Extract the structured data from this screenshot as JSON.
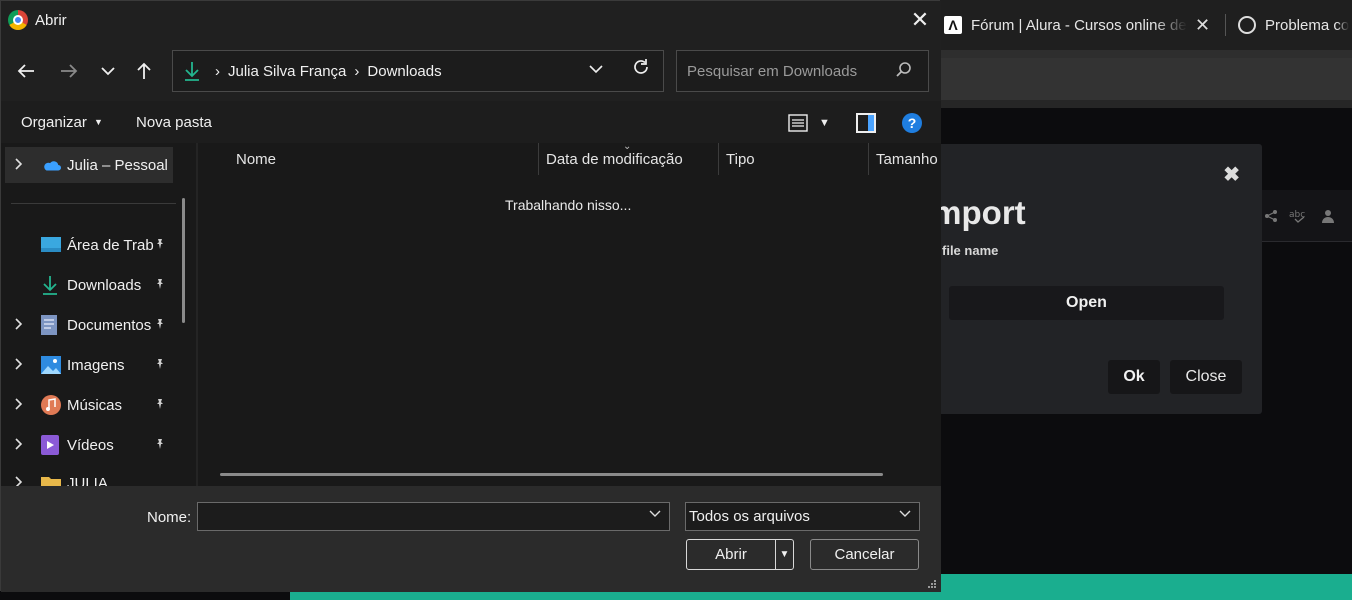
{
  "dialog": {
    "title": "Abrir",
    "breadcrumb": [
      "Julia Silva França",
      "Downloads"
    ],
    "search_placeholder": "Pesquisar em Downloads",
    "commands": {
      "organize": "Organizar",
      "new_folder": "Nova pasta"
    },
    "columns": [
      "Nome",
      "Data de modificação",
      "Tipo",
      "Tamanho"
    ],
    "status_text": "Trabalhando nisso...",
    "nav_items": [
      {
        "label": "Julia – Pessoal",
        "icon": "onedrive-cloud-icon",
        "expandable": true,
        "pinned": false,
        "selected": true
      },
      {
        "label": "Área de Trab",
        "icon": "desktop-icon",
        "expandable": false,
        "pinned": true
      },
      {
        "label": "Downloads",
        "icon": "download-icon",
        "expandable": false,
        "pinned": true
      },
      {
        "label": "Documentos",
        "icon": "documents-icon",
        "expandable": true,
        "pinned": true
      },
      {
        "label": "Imagens",
        "icon": "pictures-icon",
        "expandable": true,
        "pinned": true
      },
      {
        "label": "Músicas",
        "icon": "music-icon",
        "expandable": true,
        "pinned": true
      },
      {
        "label": "Vídeos",
        "icon": "videos-icon",
        "expandable": true,
        "pinned": true
      },
      {
        "label": "JULIA",
        "icon": "folder-icon",
        "expandable": true,
        "pinned": false
      }
    ],
    "footer": {
      "name_label": "Nome:",
      "name_value": "",
      "filter_value": "Todos os arquivos",
      "open_label": "Abrir",
      "cancel_label": "Cancelar"
    }
  },
  "browser": {
    "tabs": [
      {
        "title": "Fórum | Alura - Cursos online de",
        "icon": "alura-icon"
      },
      {
        "title": "Problema co",
        "icon": "chatgpt-icon"
      }
    ]
  },
  "modal": {
    "title": "Import",
    "label": "file name",
    "open_button": "Open",
    "ok_button": "Ok",
    "close_button": "Close"
  },
  "colors": {
    "accent_green": "#1aae8f",
    "help_blue": "#1f7ee0",
    "dialog_bg": "#191919"
  }
}
